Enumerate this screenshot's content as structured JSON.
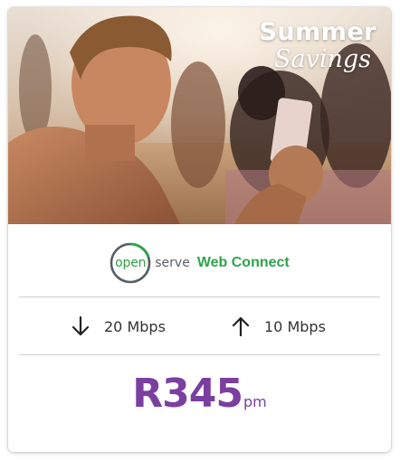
{
  "hero": {
    "icon": "beach-photo",
    "promo_line1": "Summer",
    "promo_line2": "Savings"
  },
  "brand": {
    "logo_word1": "open",
    "logo_word2": "serve",
    "product": "Web Connect",
    "colors": {
      "green": "#2fa34a",
      "grey": "#555f66"
    }
  },
  "speeds": {
    "download": {
      "icon": "arrow-down-icon",
      "label": "20 Mbps"
    },
    "upload": {
      "icon": "arrow-up-icon",
      "label": "10 Mbps"
    }
  },
  "price": {
    "amount": "R345",
    "period": "pm",
    "color": "#7b3fa0"
  }
}
